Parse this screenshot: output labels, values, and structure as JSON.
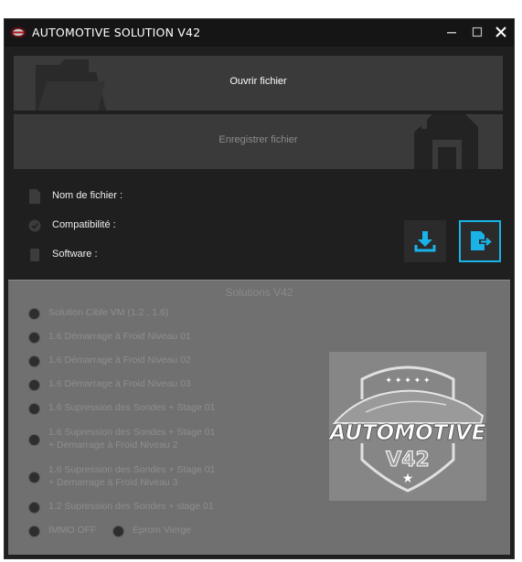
{
  "window": {
    "title": "AUTOMOTIVE SOLUTION  V42",
    "controls": [
      "minimize",
      "maximize",
      "close"
    ]
  },
  "file_buttons": {
    "open_label": "Ouvrir fichier",
    "save_label": "Enregistrer fichier"
  },
  "file_info": {
    "filename_label": "Nom de fichier  :",
    "filename_value": "",
    "compat_label": "Compatibilité :",
    "compat_value": "",
    "software_label": "Software :",
    "software_value": ""
  },
  "solutions": {
    "title": "Solutions V42",
    "items": [
      {
        "label": "Solution Cible VM (1.2 , 1.6)"
      },
      {
        "label": "1.6 Démarrage à Froid Niveau 01"
      },
      {
        "label": "1.6 Démarrage à Froid Niveau 02"
      },
      {
        "label": "1.6 Démarrage à Froid Niveau 03"
      },
      {
        "label": "1.6 Supression des Sondes + Stage 01"
      },
      {
        "label": "1.6 Supression des Sondes + Stage 01",
        "label2": "+ Demarrage à Froid Niveau 2"
      },
      {
        "label": "1.6 Supression des Sondes + Stage 01",
        "label2": "+ Demarrage à Froid Niveau 3"
      },
      {
        "label": "1.2 Supression des Sondes + stage 01"
      }
    ],
    "immo_label": "IMMO OFF",
    "eprom_label": "Eprom Vierge"
  },
  "logo": {
    "word": "AUTOMOTIVE",
    "version": "V42"
  },
  "colors": {
    "window_bg": "#1f1f1f",
    "button_bg": "#3a3a3a",
    "accent": "#19b3e8",
    "panel_bg": "#707070"
  }
}
